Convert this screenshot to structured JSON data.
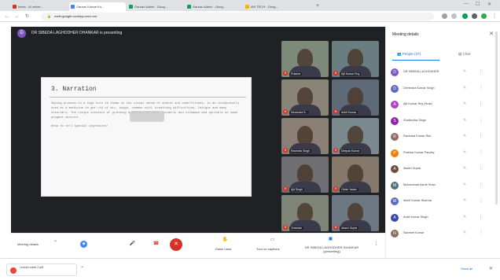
{
  "browser": {
    "tabs": [
      {
        "label": "Inbox - Ai univer...",
        "color": "#d93025"
      },
      {
        "label": "Gaurav Kumar Ku...",
        "color": "#4285f4"
      },
      {
        "label": "Gaurav Admin - Goog...",
        "color": "#0f9d58"
      },
      {
        "label": "Gaurav Admin - Goog...",
        "color": "#0f9d58"
      },
      {
        "label": "AVI TECH - Goog...",
        "color": "#f4b400"
      }
    ],
    "new_tab": "+",
    "url": "meet.google.com/rpp-xxxx-xxx",
    "minimize": "—",
    "maximize": "☐",
    "close": "✕"
  },
  "meet": {
    "presenter_initial": "D",
    "presenter_text": "DR SIBEDA LAGHODHER DHANKAR is presenting",
    "slide": {
      "title": "3. Narration",
      "paragraphs": [
        "Saying process to a high turn in theme in the visual sense of events and cheerfulness, in an incidentally used as a medicine to get rid of air, cough, common cold, breathing difficulties, fatigue and many disorders. The recipe consists of grinding a mixture of salt, turmeric and cinnamon and sprinkle on some pungent mixture.",
        "Know to tell special ingredient!"
      ]
    },
    "tiles": [
      {
        "name": "Prakhar",
        "bg": "#7d8a7a"
      },
      {
        "name": "Ajit Kumar Roy",
        "bg": "#6a7d80"
      },
      {
        "name": "Devendra S...",
        "bg": "#8a8378"
      },
      {
        "name": "Ankit Kumar",
        "bg": "#5f6a78"
      },
      {
        "name": "Ravindra Singh",
        "bg": "#8a7f74"
      },
      {
        "name": "Deepak Kumar",
        "bg": "#7a8a8e"
      },
      {
        "name": "Ajit Singh",
        "bg": "#6f6e72"
      },
      {
        "name": "Girish Yadav",
        "bg": "#85796b"
      },
      {
        "name": "Chandan",
        "bg": "#7e8478"
      },
      {
        "name": "Akash Gupta",
        "bg": "#6d7882"
      }
    ]
  },
  "controls": {
    "meeting_details": "Meeting details",
    "raise_hand": "Raise hand",
    "turn_on_captions": "Turn on captions",
    "presenting": "DR SIBEDA LAGHODHER DHANKAR (presenting)"
  },
  "sidebar": {
    "title": "Meeting details",
    "close": "✕",
    "tab_people": "People (37)",
    "tab_chat": "Chat",
    "people": [
      {
        "initial": "D",
        "color": "#7e57c2",
        "name": "DR SIBEDA LAGHODHER"
      },
      {
        "initial": "D",
        "color": "#5c6bc0",
        "name": "Devendra Kumar Singh"
      },
      {
        "initial": "A",
        "color": "#ab47bc",
        "name": "Ajit Kumar Roy (Host)"
      },
      {
        "initial": "S",
        "color": "#8e24aa",
        "name": "Shailendra Singh"
      },
      {
        "initial": "R",
        "color": "#8d6e63",
        "name": "Ravindra Kumar Rao"
      },
      {
        "initial": "P",
        "color": "#f57c00",
        "name": "Prakhar Kumar Pandey"
      },
      {
        "initial": "A",
        "color": "#6d4c41",
        "name": "Akash Gupta"
      },
      {
        "initial": "M",
        "color": "#546e7a",
        "name": "Mohammad Aamir Khan"
      },
      {
        "initial": "M",
        "color": "#5c6bc0",
        "name": "Mohit Kumar Sharma"
      },
      {
        "initial": "A",
        "color": "#3949ab",
        "name": "Ankit Kumar Singh"
      },
      {
        "initial": "N",
        "color": "#8d6e63",
        "name": "Navneet Kumar"
      }
    ]
  },
  "downloads": {
    "file": "Lecture notes 2.pdf",
    "show_all": "Show all",
    "close": "✕"
  }
}
